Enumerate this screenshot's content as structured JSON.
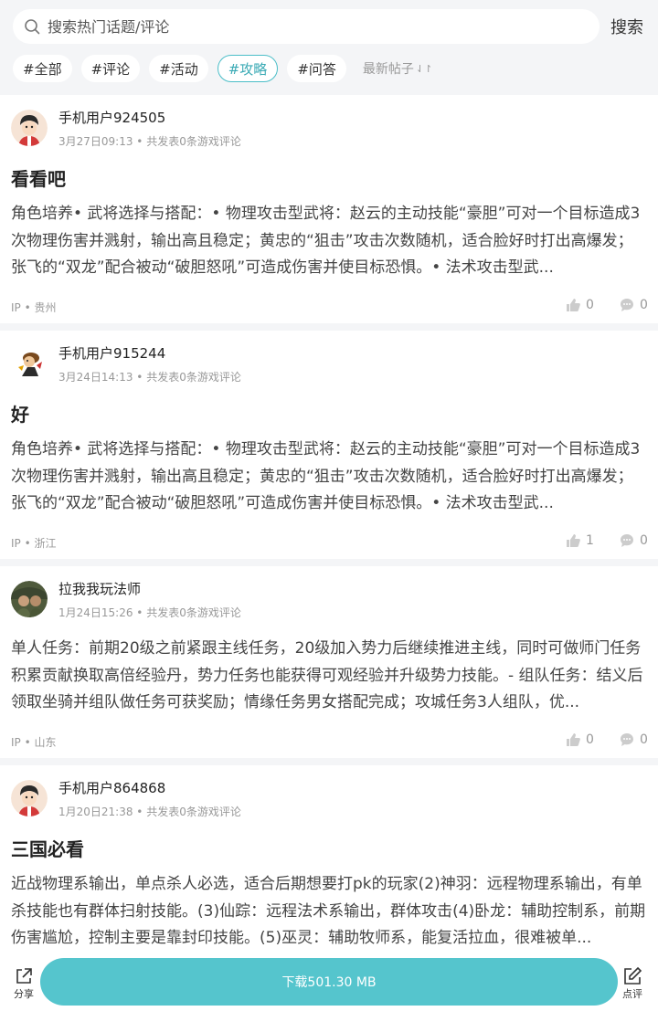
{
  "search": {
    "placeholder": "搜索热门话题/评论",
    "button": "搜索"
  },
  "filters": [
    {
      "label": "#全部",
      "active": false
    },
    {
      "label": "#评论",
      "active": false
    },
    {
      "label": "#活动",
      "active": false
    },
    {
      "label": "#攻略",
      "active": true
    },
    {
      "label": "#问答",
      "active": false
    }
  ],
  "sort_label": "最新帖子",
  "accent_color": "#55c5cd",
  "posts": [
    {
      "user": "手机用户924505",
      "meta": "3月27日09:13 • 共发表0条游戏评论",
      "title": "看看吧",
      "content": "角色培养• 武将选择与搭配：• 物理攻击型武将：赵云的主动技能“豪胆”可对一个目标造成3次物理伤害并溅射，输出高且稳定；黄忠的“狙击”攻击次数随机，适合脸好时打出高爆发；张飞的“双龙”配合被动“破胆怒吼”可造成伤害并使目标恐惧。• 法术攻击型武...",
      "ip": "IP • 贵州",
      "likes": "0",
      "comments": "0"
    },
    {
      "user": "手机用户915244",
      "meta": "3月24日14:13 • 共发表0条游戏评论",
      "title": "好",
      "content": "角色培养• 武将选择与搭配：• 物理攻击型武将：赵云的主动技能“豪胆”可对一个目标造成3次物理伤害并溅射，输出高且稳定；黄忠的“狙击”攻击次数随机，适合脸好时打出高爆发；张飞的“双龙”配合被动“破胆怒吼”可造成伤害并使目标恐惧。• 法术攻击型武...",
      "ip": "IP • 浙江",
      "likes": "1",
      "comments": "0"
    },
    {
      "user": "拉我我玩法师",
      "meta": "1月24日15:26 • 共发表0条游戏评论",
      "title": "",
      "content": "单人任务：前期20级之前紧跟主线任务，20级加入势力后继续推进主线，同时可做师门任务积累贡献换取高倍经验丹，势力任务也能获得可观经验并升级势力技能。- 组队任务：结义后领取坐骑并组队做任务可获奖励；情缘任务男女搭配完成；攻城任务3人组队，优...",
      "ip": "IP • 山东",
      "likes": "0",
      "comments": "0"
    },
    {
      "user": "手机用户864868",
      "meta": "1月20日21:38 • 共发表0条游戏评论",
      "title": "三国必看",
      "content": "近战物理系输出，单点杀人必选，适合后期想要打pk的玩家(2)神羽：远程物理系输出，有单杀技能也有群体扫射技能。(3)仙踪：远程法术系输出，群体攻击(4)卧龙：辅助控制系，前期伤害尴尬，控制主要是靠封印技能。(5)巫灵：辅助牧师系，能复活拉血，很难被单...",
      "ip": "",
      "likes": "",
      "comments": ""
    }
  ],
  "bottom": {
    "share": "分享",
    "download": "下载501.30 MB",
    "review": "点评"
  }
}
